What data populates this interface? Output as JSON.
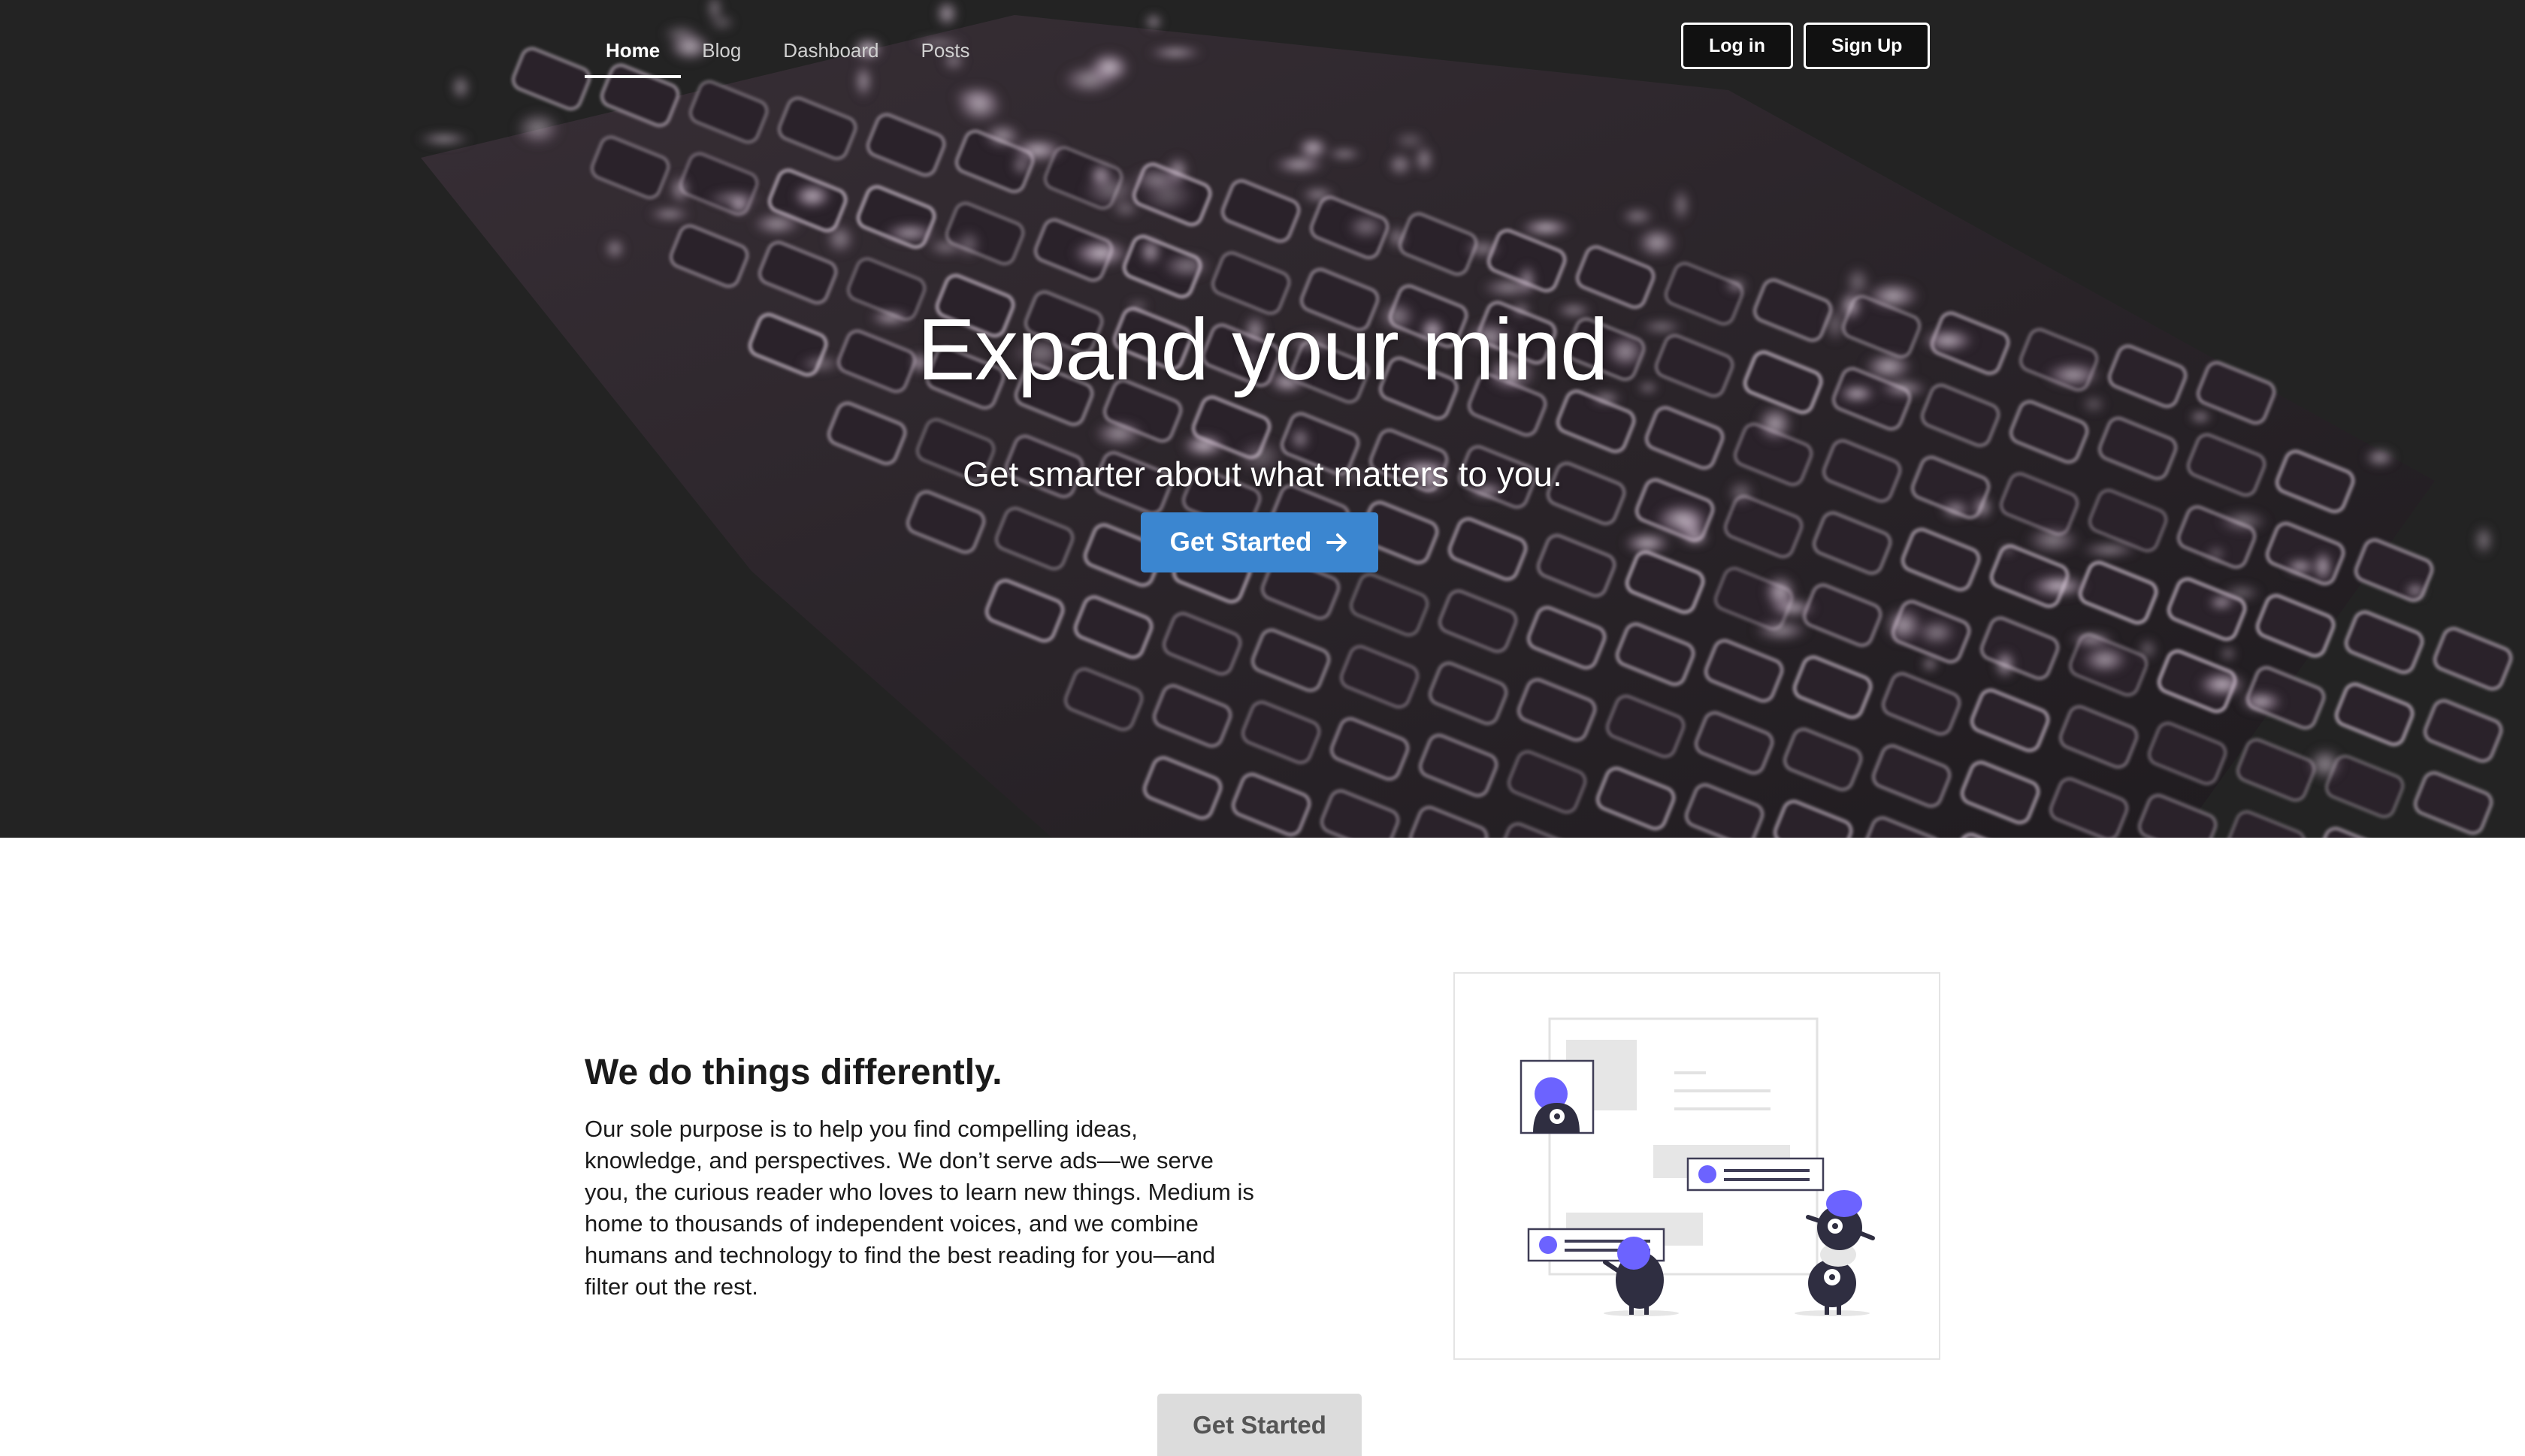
{
  "nav": {
    "items": [
      {
        "label": "Home",
        "active": true
      },
      {
        "label": "Blog",
        "active": false
      },
      {
        "label": "Dashboard",
        "active": false
      },
      {
        "label": "Posts",
        "active": false
      }
    ]
  },
  "auth": {
    "login_label": "Log in",
    "signup_label": "Sign Up"
  },
  "hero": {
    "title": "Expand your mind",
    "subtitle": "Get smarter about what matters to you.",
    "cta_label": "Get Started",
    "cta_icon": "arrow-right-icon"
  },
  "feature": {
    "title": "We do things differently.",
    "body": "Our sole purpose is to help you find compelling ideas, knowledge, and perspectives. We don’t serve ads—we serve you, the curious reader who loves to learn new things. Medium is home to thousands of independent voices, and we combine humans and technology to find the best reading for you—and filter out the rest."
  },
  "footer_cta": {
    "label": "Get Started"
  },
  "colors": {
    "hero_bg": "#232323",
    "primary": "#3b86d0",
    "accent_purple": "#6c63ff",
    "secondary_btn": "#dcdcdc"
  }
}
